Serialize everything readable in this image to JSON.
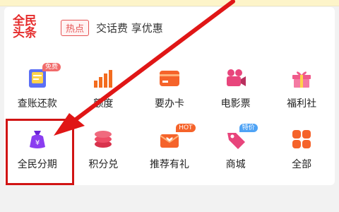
{
  "news": {
    "logo_line1": "全民",
    "logo_line2": "头条",
    "tag": "热点",
    "headline": "交话费 享优惠"
  },
  "grid": {
    "row1": [
      {
        "label": "查账还款",
        "icon": "ledger-icon",
        "badge": "免费"
      },
      {
        "label": "额度",
        "icon": "bar-chart-icon"
      },
      {
        "label": "要办卡",
        "icon": "credit-card-icon"
      },
      {
        "label": "电影票",
        "icon": "movie-camera-icon"
      },
      {
        "label": "福利社",
        "icon": "gift-icon"
      }
    ],
    "row2": [
      {
        "label": "全民分期",
        "icon": "money-bag-icon"
      },
      {
        "label": "积分兑",
        "icon": "coin-stack-icon"
      },
      {
        "label": "推荐有礼",
        "icon": "envelope-heart-icon",
        "badge": "HOT"
      },
      {
        "label": "商城",
        "icon": "price-tag-icon",
        "badge": "特价"
      },
      {
        "label": "全部",
        "icon": "grid-squares-icon"
      }
    ]
  },
  "colors": {
    "highlight": "#d11414",
    "accent_orange": "#f5632a",
    "accent_purple": "#8a3df0"
  }
}
